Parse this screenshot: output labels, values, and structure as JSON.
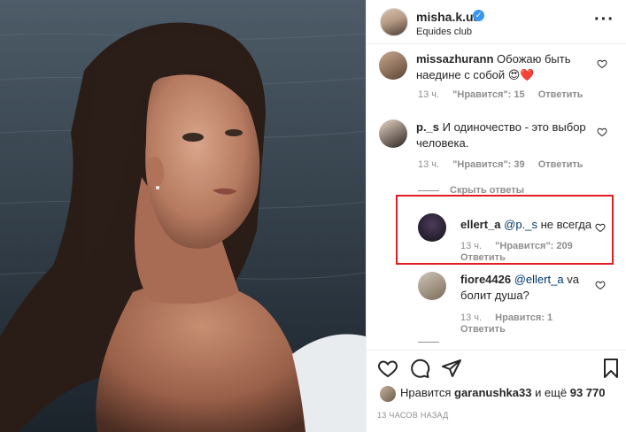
{
  "post": {
    "username": "misha.k.ua",
    "location": "Equides club",
    "verified_mark": "✓"
  },
  "comments": [
    {
      "username": "missazhurann",
      "text": "Обожаю быть наедине с собой",
      "emoji": "😍❤️",
      "time": "13 ч.",
      "likes": "\"Нравится\": 15",
      "reply": "Ответить"
    },
    {
      "username": "p._s",
      "text": "И одиночество - это выбор человека.",
      "time": "13 ч.",
      "likes": "\"Нравится\": 39",
      "reply": "Ответить",
      "hide_replies": "Скрыть ответы",
      "replies": [
        {
          "username": "ellert_a",
          "mention": "@p._s",
          "text": "не всегда",
          "time": "13 ч.",
          "likes": "\"Нравится\": 209",
          "reply": "Ответить"
        },
        {
          "username": "fiore4426",
          "mention": "@ellert_a",
          "text": "va болит душа?",
          "time": "13 ч.",
          "likes": "Нравится: 1",
          "reply": "Ответить"
        }
      ]
    }
  ],
  "footer": {
    "likes_prefix": "Нравится",
    "likes_user": "garanushka33",
    "likes_suffix": "и ещё",
    "likes_count": "93 770",
    "timestamp": "13 ЧАСОВ НАЗАД"
  },
  "icons": [
    "more-icon",
    "heart-icon",
    "comment-icon",
    "share-icon",
    "bookmark-icon"
  ],
  "colors": {
    "highlight": "#e31b23",
    "verified": "#3897f0",
    "mention": "#00376b",
    "meta": "#8e8e8e"
  }
}
